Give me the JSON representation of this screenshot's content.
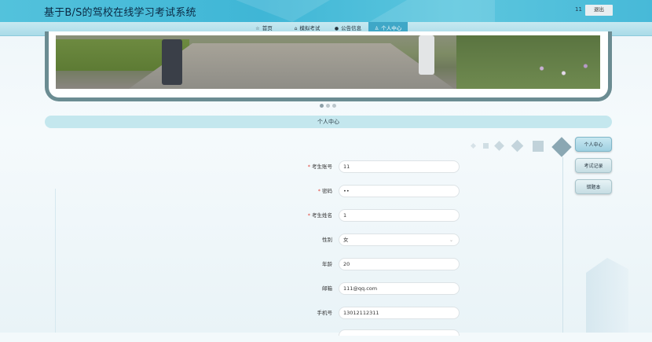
{
  "header": {
    "site_title": "基于B/S的驾校在线学习考试系统",
    "user_name": "11",
    "logout_label": "退出"
  },
  "nav": {
    "items": [
      {
        "label": "首页",
        "icon": "star-icon"
      },
      {
        "label": "模拟考试",
        "icon": "bag-icon"
      },
      {
        "label": "公告信息",
        "icon": "info-icon"
      },
      {
        "label": "个人中心",
        "icon": "user-icon",
        "active": true
      }
    ]
  },
  "carousel": {
    "dots": 3,
    "active_index": 0
  },
  "section": {
    "title": "个人中心"
  },
  "side_menu": {
    "items": [
      {
        "label": "个人中心",
        "active": true
      },
      {
        "label": "考试记录",
        "active": false
      },
      {
        "label": "错题本",
        "active": false
      }
    ]
  },
  "form": {
    "fields": [
      {
        "label": "考生账号",
        "required": true,
        "value": "11"
      },
      {
        "label": "密码",
        "required": true,
        "value": "••"
      },
      {
        "label": "考生姓名",
        "required": true,
        "value": "1"
      },
      {
        "label": "性别",
        "required": false,
        "value": "女",
        "type": "select"
      },
      {
        "label": "年龄",
        "required": false,
        "value": "20"
      },
      {
        "label": "邮箱",
        "required": false,
        "value": "111@qq.com"
      },
      {
        "label": "手机号",
        "required": false,
        "value": "13012112311"
      }
    ]
  },
  "colors": {
    "header_bg": "#47b9d8",
    "nav_active": "#3fa7c7",
    "section_bar": "#c4e7ee",
    "required": "#e0463c"
  }
}
